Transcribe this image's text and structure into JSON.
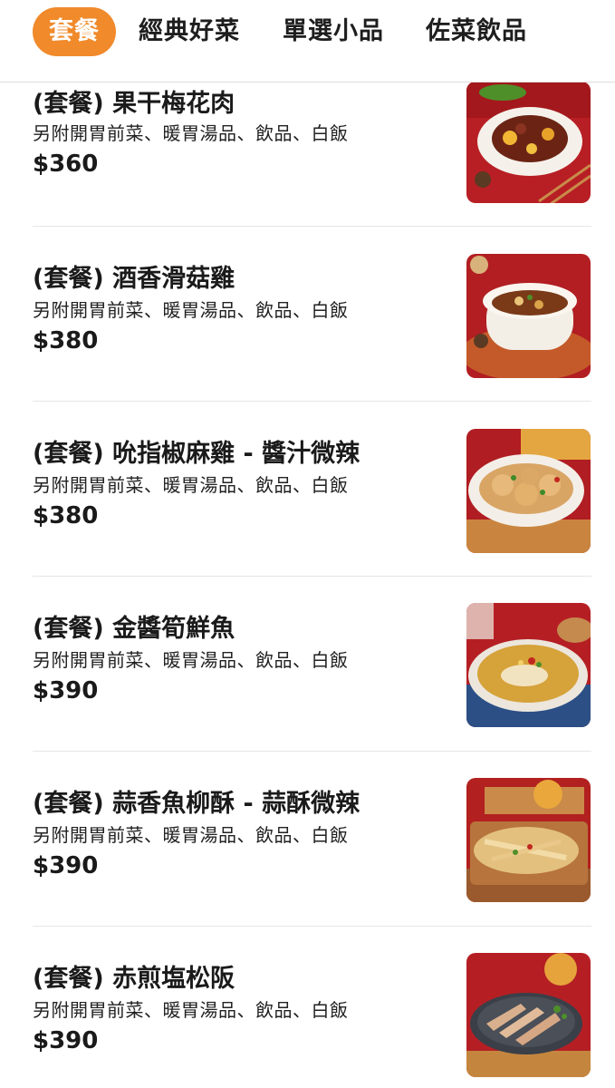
{
  "tabs": [
    {
      "label": "套餐",
      "active": true
    },
    {
      "label": "經典好菜",
      "active": false
    },
    {
      "label": "單選小品",
      "active": false
    },
    {
      "label": "佐菜飲品",
      "active": false
    }
  ],
  "items": [
    {
      "name": "(套餐) 果干梅花肉",
      "desc": "另附開胃前菜、暖胃湯品、飲品、白飯",
      "price": "$360"
    },
    {
      "name": "(套餐) 酒香滑菇雞",
      "desc": "另附開胃前菜、暖胃湯品、飲品、白飯",
      "price": "$380"
    },
    {
      "name": "(套餐) 吮指椒麻雞 - 醬汁微辣",
      "desc": "另附開胃前菜、暖胃湯品、飲品、白飯",
      "price": "$380"
    },
    {
      "name": "(套餐) 金醬筍鮮魚",
      "desc": "另附開胃前菜、暖胃湯品、飲品、白飯",
      "price": "$390"
    },
    {
      "name": "(套餐) 蒜香魚柳酥 - 蒜酥微辣",
      "desc": "另附開胃前菜、暖胃湯品、飲品、白飯",
      "price": "$390"
    },
    {
      "name": "(套餐) 赤煎塩松阪",
      "desc": "另附開胃前菜、暖胃湯品、飲品、白飯",
      "price": "$390"
    }
  ],
  "colors": {
    "accent": "#f08a2b",
    "photo_background": "#b51f25"
  }
}
